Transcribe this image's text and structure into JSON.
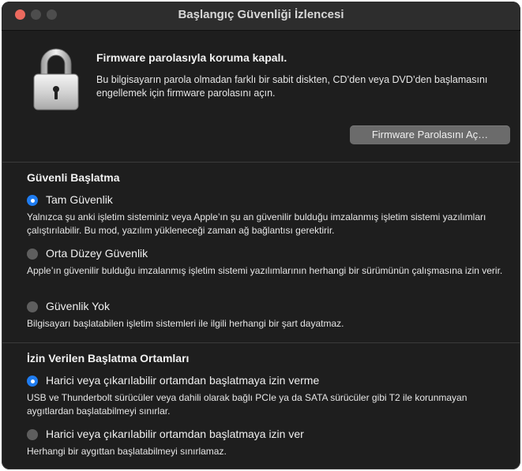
{
  "window": {
    "title": "Başlangıç Güvenliği İzlencesi"
  },
  "firmware": {
    "title": "Firmware parolasıyla koruma kapalı.",
    "description": "Bu bilgisayarın parola olmadan farklı bir sabit diskten, CD’den veya DVD’den başlamasını engellemek için firmware parolasını açın.",
    "button_label": "Firmware Parolasını Aç…",
    "icon": "lock-icon"
  },
  "secure_boot": {
    "title": "Güvenli Başlatma",
    "options": [
      {
        "label": "Tam Güvenlik",
        "selected": true,
        "description": "Yalnızca şu anki işletim sisteminiz veya Apple’ın şu an güvenilir bulduğu imzalanmış işletim sistemi yazılımları çalıştırılabilir. Bu mod, yazılım yükleneceği zaman ağ bağlantısı gerektirir."
      },
      {
        "label": "Orta Düzey Güvenlik",
        "selected": false,
        "description": "Apple’ın güvenilir bulduğu imzalanmış işletim sistemi yazılımlarının herhangi bir sürümünün çalışmasına izin verir."
      },
      {
        "label": "Güvenlik Yok",
        "selected": false,
        "description": "Bilgisayarı başlatabilen işletim sistemleri ile ilgili herhangi bir şart dayatmaz."
      }
    ]
  },
  "allowed_media": {
    "title": "İzin Verilen Başlatma Ortamları",
    "options": [
      {
        "label": "Harici veya çıkarılabilir ortamdan başlatmaya izin verme",
        "selected": true,
        "description": "USB ve Thunderbolt sürücüler veya dahili olarak bağlı PCIe ya da SATA sürücüler gibi T2 ile korunmayan aygıtlardan başlatabilmeyi sınırlar."
      },
      {
        "label": "Harici veya çıkarılabilir ortamdan başlatmaya izin ver",
        "selected": false,
        "description": "Herhangi bir aygıttan başlatabilmeyi sınırlamaz."
      }
    ]
  },
  "colors": {
    "background": "#1e1e1e",
    "accent": "#1f7cf0",
    "close_button": "#ec6a5e"
  }
}
